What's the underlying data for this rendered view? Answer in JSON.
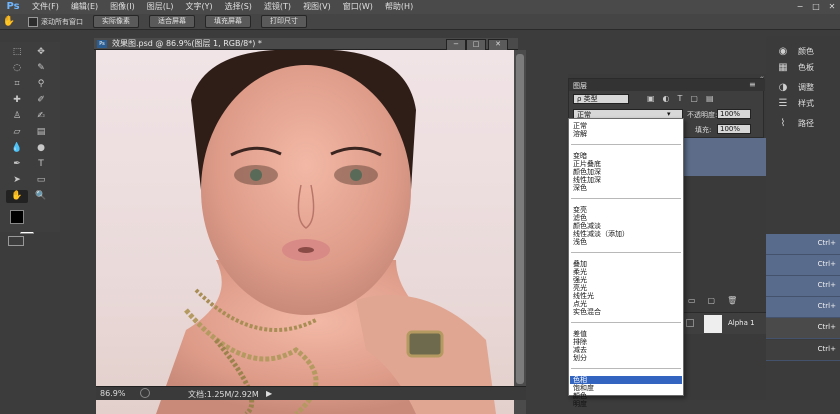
{
  "app": {
    "logo": "Ps"
  },
  "menubar": {
    "items": [
      "文件(F)",
      "编辑(E)",
      "图像(I)",
      "图层(L)",
      "文字(Y)",
      "选择(S)",
      "滤镜(T)",
      "视图(V)",
      "窗口(W)",
      "帮助(H)"
    ]
  },
  "window_controls": {
    "minimize": "−",
    "restore": "□",
    "close": "✕"
  },
  "optionsbar": {
    "scroll_all_label": "滚动所有窗口",
    "buttons": [
      "实际像素",
      "适合屏幕",
      "填充屏幕",
      "打印尺寸"
    ]
  },
  "document": {
    "title": "效果图.psd @ 86.9%(图层 1, RGB/8*) *",
    "zoom": "86.9%",
    "doc_size": "文档:1.25M/2.92M"
  },
  "layers": {
    "tab_label": "图层",
    "filter_label": "ρ 类型",
    "blend_mode": "正常",
    "opacity_label": "不透明度:",
    "opacity_value": "100%",
    "fill_label": "填充:",
    "fill_value": "100%",
    "alpha_layer_name": "Alpha 1"
  },
  "blend_menu": {
    "groups": [
      [
        "正常",
        "溶解"
      ],
      [
        "变暗",
        "正片叠底",
        "颜色加深",
        "线性加深",
        "深色"
      ],
      [
        "变亮",
        "滤色",
        "颜色减淡",
        "线性减淡（添加）",
        "浅色"
      ],
      [
        "叠加",
        "柔光",
        "强光",
        "亮光",
        "线性光",
        "点光",
        "实色混合"
      ],
      [
        "差值",
        "排除",
        "减去",
        "划分"
      ],
      [
        "色相",
        "饱和度",
        "颜色",
        "明度"
      ]
    ],
    "highlighted": "色相"
  },
  "right_dock": {
    "items": [
      {
        "icon": "palette-icon",
        "label": "颜色"
      },
      {
        "icon": "swatches-icon",
        "label": "色板"
      },
      {
        "icon": "adjustments-icon",
        "label": "调整"
      },
      {
        "icon": "styles-icon",
        "label": "样式"
      },
      {
        "icon": "paths-icon",
        "label": "路径"
      }
    ],
    "shortcuts": [
      "Ctrl+",
      "Ctrl+",
      "Ctrl+",
      "Ctrl+",
      "Ctrl+",
      "Ctrl+"
    ]
  },
  "colors": {
    "highlight": "#3264c0",
    "channel_row": "#596b8c"
  }
}
